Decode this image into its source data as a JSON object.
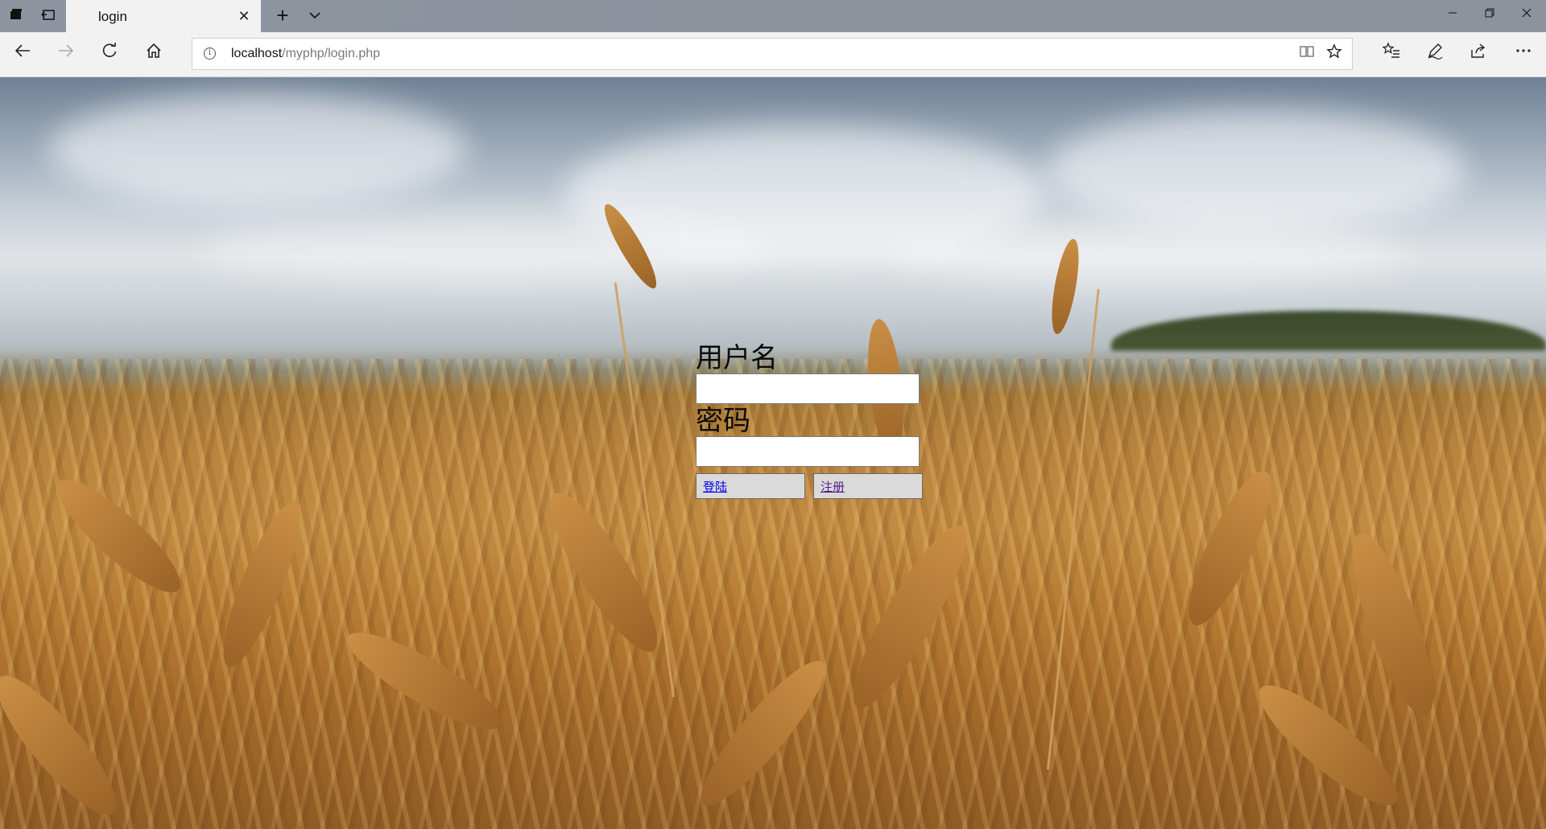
{
  "browser": {
    "tab": {
      "title": "login"
    },
    "address": {
      "host": "localhost",
      "path": "/myphp/login.php"
    }
  },
  "icons": {
    "set_aside_tabs": "set-aside-tabs-icon",
    "restore_tabs": "restore-tabs-icon",
    "tab_close": "close-icon",
    "new_tab": "plus-icon",
    "tab_list": "chevron-down-icon",
    "back": "back-arrow-icon",
    "forward": "forward-arrow-icon",
    "refresh": "refresh-icon",
    "home": "home-icon",
    "site_info": "info-icon",
    "reading_view": "reading-view-icon",
    "favorite": "star-icon",
    "favorites_hub": "favorites-list-icon",
    "web_note": "pen-icon",
    "share": "share-icon",
    "more": "more-icon"
  },
  "login_form": {
    "username_label": "用户名",
    "username_value": "",
    "password_label": "密码",
    "password_value": "",
    "login_button": "登陆",
    "register_button": "注册"
  },
  "colors": {
    "tab_strip": "#8e95a0",
    "toolbar": "#f2f2f2",
    "login_link": "#0000ee",
    "register_link": "#551a8b"
  }
}
